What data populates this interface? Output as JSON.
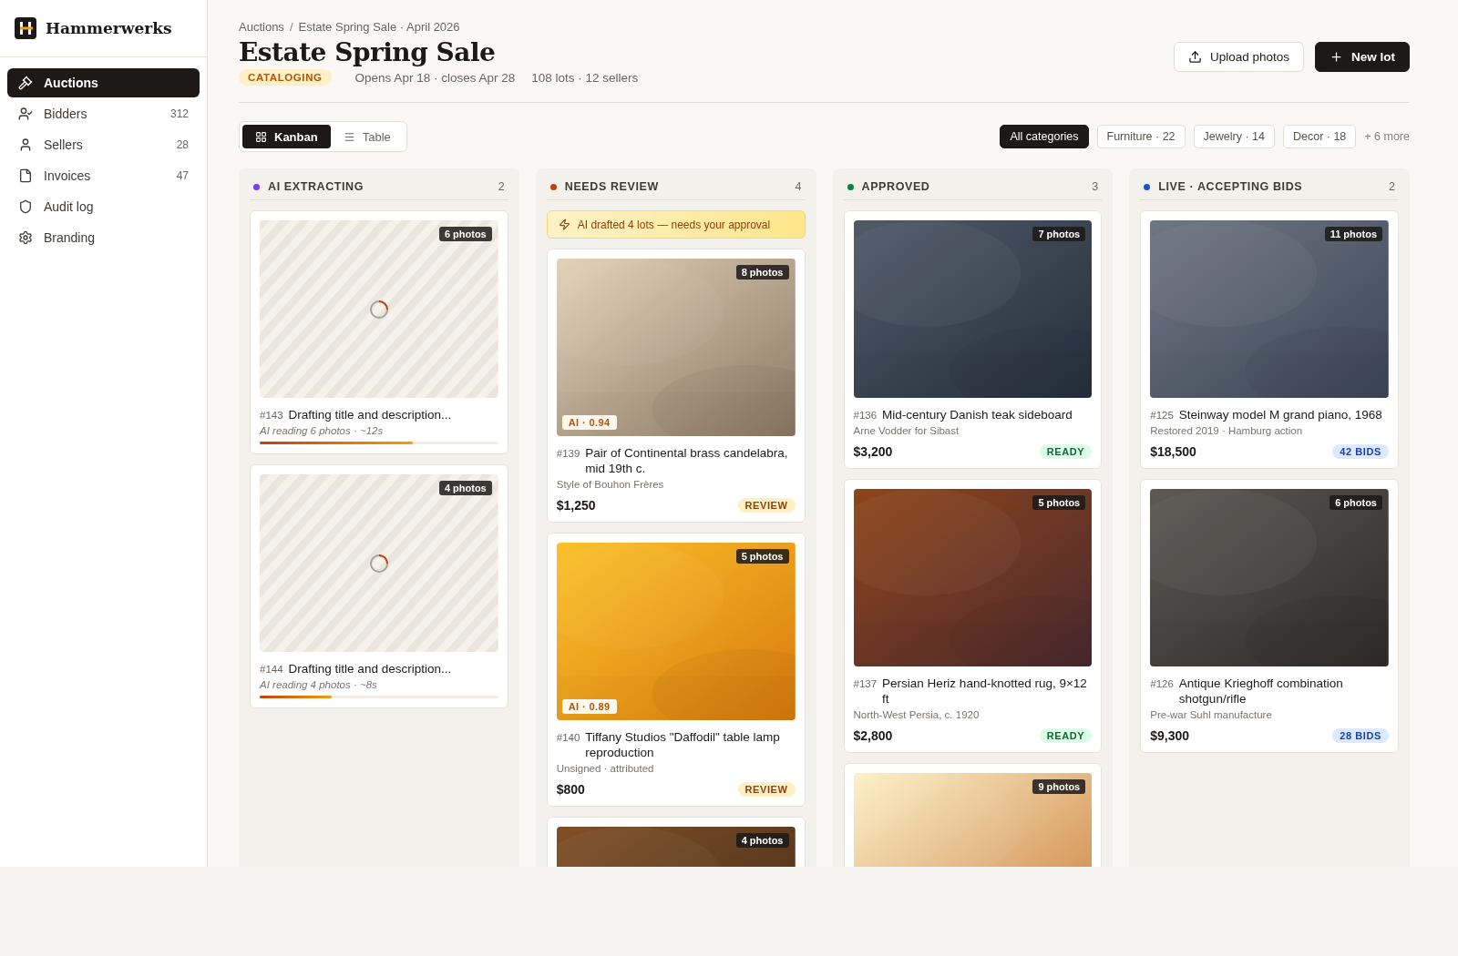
{
  "sidebar": {
    "brand": "Hammerwerks",
    "items": [
      {
        "label": "Auctions",
        "selected": true
      },
      {
        "label": "Bidders",
        "count": "312",
        "selected": false
      },
      {
        "label": "Sellers",
        "count": "28",
        "selected": false
      },
      {
        "label": "Invoices",
        "count": "47",
        "selected": false
      },
      {
        "label": "Audit log",
        "selected": false
      },
      {
        "label": "Branding",
        "selected": false
      }
    ]
  },
  "header": {
    "breadcrumb": [
      "Auctions",
      "/",
      "Estate Spring Sale · April 2026"
    ],
    "title": "Estate Spring Sale",
    "status": "CATALOGING",
    "dates": "Opens Apr 18 · closes Apr 28",
    "stats": "108 lots · 12 sellers",
    "actions": [
      {
        "label": "Upload photos",
        "kind": "secondary"
      },
      {
        "label": "New lot",
        "kind": "primary"
      }
    ]
  },
  "view_toggle": [
    {
      "label": "Kanban",
      "selected": true
    },
    {
      "label": "Table",
      "selected": false
    }
  ],
  "filters": [
    {
      "label": "All categories",
      "selected": true
    },
    {
      "label": "Furniture · 22",
      "selected": false
    },
    {
      "label": "Jewelry · 14",
      "selected": false
    },
    {
      "label": "Decor · 18",
      "selected": false
    }
  ],
  "more_filters": "+ 6 more",
  "columns": [
    {
      "title": "AI EXTRACTING",
      "count": "2",
      "color": "#7c3aed",
      "cards": [
        {
          "kind": "extracting",
          "photos": "6 photos",
          "number": "#143",
          "title": "Drafting title and description...",
          "note": "AI reading 6 photos · ~12s",
          "level": 0.64
        },
        {
          "kind": "extracting",
          "photos": "4 photos",
          "number": "#144",
          "title": "Drafting title and description...",
          "note": "AI reading 4 photos · ~8s",
          "level": 0.3
        }
      ]
    },
    {
      "title": "NEEDS REVIEW",
      "count": "4",
      "color": "#c2410c",
      "notice": "AI drafted 4 lots — needs your approval",
      "cards": [
        {
          "kind": "lot",
          "photos": "8 photos",
          "ai_score": "AI · 0.94",
          "number": "#139",
          "title": "Pair of Continental brass candelabra, mid 19th c.",
          "subtitle": "Style of Bouhon Frères",
          "price": "$1,250",
          "status": {
            "label": "REVIEW",
            "kind": "review"
          }
        },
        {
          "kind": "lot",
          "photos": "5 photos",
          "ai_score": "AI · 0.89",
          "number": "#140",
          "title": "Tiffany Studios \"Daffodil\" table lamp reproduction",
          "subtitle": "Unsigned · attributed",
          "price": "$800",
          "status": {
            "label": "REVIEW",
            "kind": "review"
          }
        },
        {
          "kind": "lot",
          "photos": "4 photos"
        }
      ]
    },
    {
      "title": "APPROVED",
      "count": "3",
      "color": "#15803d",
      "cards": [
        {
          "kind": "lot",
          "photos": "7 photos",
          "number": "#136",
          "title": "Mid-century Danish teak sideboard",
          "subtitle": "Arne Vodder for Sibast",
          "price": "$3,200",
          "status": {
            "label": "READY",
            "kind": "ready"
          }
        },
        {
          "kind": "lot",
          "photos": "5 photos",
          "number": "#137",
          "title": "Persian Heriz hand-knotted rug, 9×12 ft",
          "subtitle": "North-West Persia, c. 1920",
          "price": "$2,800",
          "status": {
            "label": "READY",
            "kind": "ready"
          }
        },
        {
          "kind": "lot",
          "photos": "9 photos"
        }
      ]
    },
    {
      "title": "LIVE · ACCEPTING BIDS",
      "count": "2",
      "color": "#1d4ed8",
      "cards": [
        {
          "kind": "lot",
          "photos": "11 photos",
          "number": "#125",
          "title": "Steinway model M grand piano, 1968",
          "subtitle": "Restored 2019 · Hamburg action",
          "price": "$18,500",
          "status": {
            "label": "42 BIDS",
            "kind": "bids"
          }
        },
        {
          "kind": "lot",
          "photos": "6 photos",
          "number": "#126",
          "title": "Antique Krieghoff combination shotgun/rifle",
          "subtitle": "Pre-war Suhl manufacture",
          "price": "$9,300",
          "status": {
            "label": "28 BIDS",
            "kind": "bids"
          }
        }
      ]
    }
  ]
}
